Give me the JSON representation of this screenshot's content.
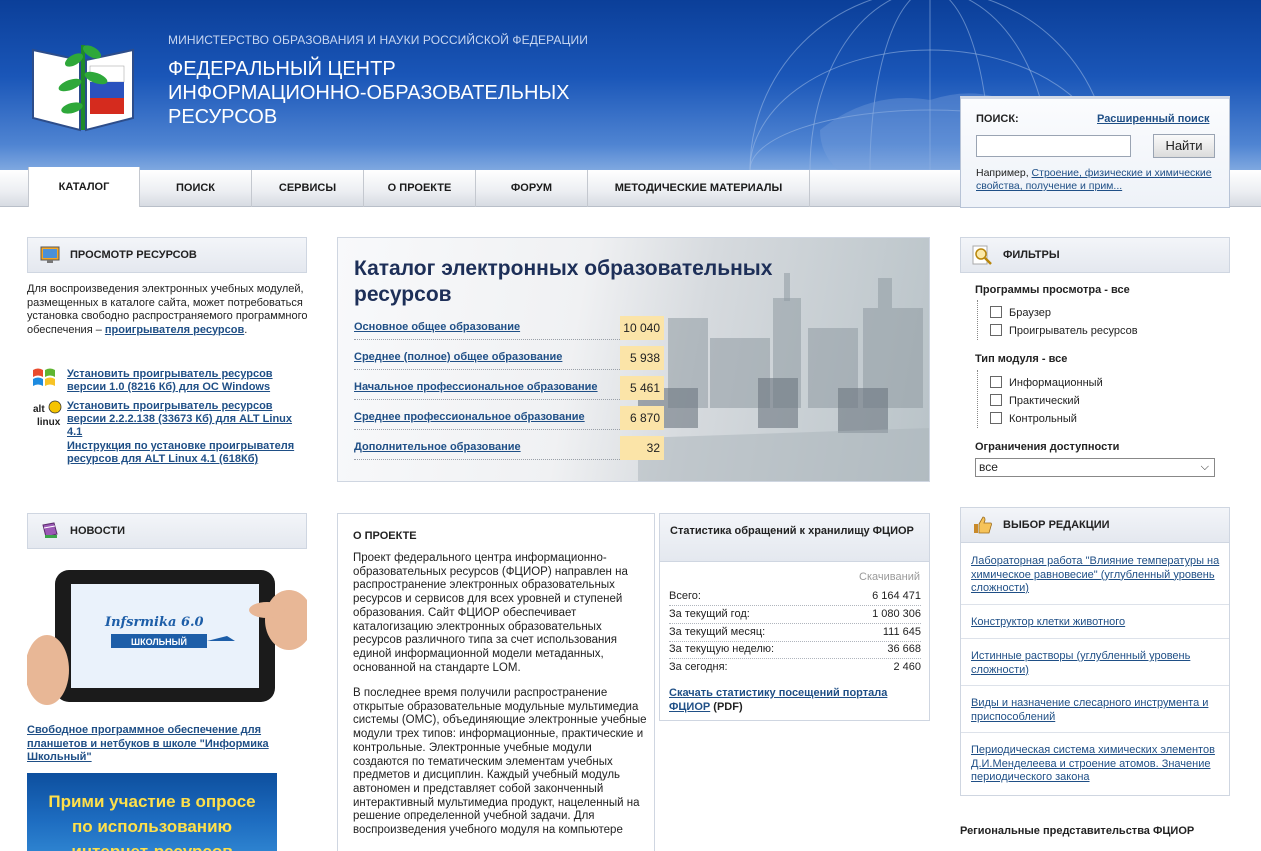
{
  "header": {
    "ministry": "МИНИСТЕРСТВО ОБРАЗОВАНИЯ И НАУКИ РОССИЙСКОЙ ФЕДЕРАЦИИ",
    "title_line1": "ФЕДЕРАЛЬНЫЙ ЦЕНТР",
    "title_line2": "ИНФОРМАЦИОННО-ОБРАЗОВАТЕЛЬНЫХ",
    "title_line3": "РЕСУРСОВ"
  },
  "nav": {
    "items": [
      "КАТАЛОГ",
      "ПОИСК",
      "СЕРВИСЫ",
      "О ПРОЕКТЕ",
      "ФОРУМ",
      "МЕТОДИЧЕСКИЕ МАТЕРИАЛЫ"
    ],
    "active": "КАТАЛОГ"
  },
  "search": {
    "label": "ПОИСК:",
    "advanced": "Расширенный поиск",
    "value": "",
    "button": "Найти",
    "example_prefix": "Например, ",
    "example_link": "Строение, физические и химические свойства, получение и прим..."
  },
  "browse": {
    "title": "ПРОСМОТР РЕСУРСОВ",
    "text": "Для воспроизведения электронных учебных модулей, размещенных в каталоге сайта, может потребоваться установка свободно распространяемого программного обеспечения – ",
    "text_link": "проигрывателя ресурсов",
    "text_end": ".",
    "download_windows": "Установить проигрыватель ресурсов версии 1.0 (8216 Кб) для ОС Windows",
    "download_alt": "Установить проигрыватель ресурсов версии 2.2.2.138 (33673 Кб) для ALT Linux 4.1",
    "instructions_alt": "Инструкция по установке проигрывателя ресурсов для ALT Linux 4.1 (618Кб)"
  },
  "catalog": {
    "title": "Каталог электронных образовательных ресурсов",
    "rows": [
      {
        "label": "Основное общее образование",
        "count": "10 040"
      },
      {
        "label": "Среднее (полное) общее образование",
        "count": "5 938"
      },
      {
        "label": "Начальное профессиональное образование",
        "count": "5 461"
      },
      {
        "label": "Среднее профессиональное образование",
        "count": "6 870"
      },
      {
        "label": "Дополнительное образование",
        "count": "32"
      }
    ]
  },
  "about": {
    "title": "О ПРОЕКТЕ",
    "p1": "Проект федерального центра информационно-образовательных ресурсов (ФЦИОР) направлен на распространение электронных образовательных ресурсов и сервисов для всех уровней и ступеней образования. Сайт ФЦИОР обеспечивает каталогизацию электронных образовательных ресурсов различного типа за счет использования единой информационной модели метаданных, основанной на стандарте LOM.",
    "p2": "В последнее время получили распространение открытые образовательные модульные мультимедиа системы (ОМС), объединяющие электронные учебные модули трех типов: информационные, практические и контрольные. Электронные учебные модули создаются по тематическим элементам учебных предметов и дисциплин. Каждый учебный модуль автономен и представляет собой законченный интерактивный мультимедиа продукт, нацеленный на решение определенной учебной задачи. Для воспроизведения учебного модуля на компьютере"
  },
  "stats": {
    "title": "Статистика обращений к хранилищу ФЦИОР",
    "column": "Скачиваний",
    "rows": [
      {
        "label": "Всего:",
        "value": "6 164 471"
      },
      {
        "label": "За текущий год:",
        "value": "1 080 306"
      },
      {
        "label": "За текущий месяц:",
        "value": "111 645"
      },
      {
        "label": "За текущую неделю:",
        "value": "36 668"
      },
      {
        "label": "За сегодня:",
        "value": "2 460"
      }
    ],
    "download_link": "Скачать статистику посещений портала ФЦИОР",
    "download_suffix": " (PDF)"
  },
  "filters": {
    "title": "ФИЛЬТРЫ",
    "programs_label": "Программы просмотра - все",
    "programs": [
      "Браузер",
      "Проигрыватель ресурсов"
    ],
    "module_label": "Тип модуля - все",
    "modules": [
      "Информационный",
      "Практический",
      "Контрольный"
    ],
    "access_label": "Ограничения доступности",
    "access_value": "все"
  },
  "picks": {
    "title": "ВЫБОР РЕДАКЦИИ",
    "items": [
      "Лабораторная работа \"Влияние температуры на химическое равновесие\" (углубленный уровень сложности)",
      "Конструктор клетки животного",
      "Истинные растворы (углубленный уровень сложности)",
      "Виды и назначение слесарного инструмента и приспособлений",
      "Периодическая система химических элементов Д.И.Менделеева и строение атомов. Значение периодического закона"
    ]
  },
  "news": {
    "title": "НОВОСТИ",
    "tablet_brand": "Infsrmika 6.0",
    "tablet_sub": "ШКОЛЬНЫЙ",
    "link": "Свободное программное обеспечение для планшетов и нетбуков в школе \"Информика Школьный\"",
    "survey_line1": "Прими участие в опросе",
    "survey_line2": "по использованию",
    "survey_line3": "интернет-ресурсов"
  },
  "regional": {
    "title": "Региональные представительства ФЦИОР"
  },
  "colors": {
    "header_blue": "#1a56b8",
    "link": "#1f4f86",
    "count_bg": "#fbe4a8",
    "survey_text": "#ffe04a"
  }
}
